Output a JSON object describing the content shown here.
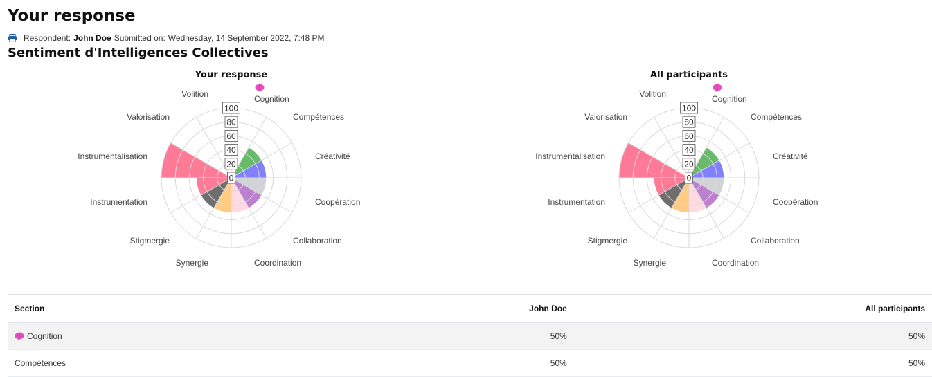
{
  "header": {
    "title": "Your response",
    "respondent_label": "Respondent:",
    "respondent_name": "John Doe",
    "submitted_label": "Submitted on:",
    "submitted_date": "Wednesday, 14 September 2022, 7:48 PM",
    "section_title": "Sentiment d'Intelligences Collectives"
  },
  "colors": {
    "brain_icon": "#e84fbf",
    "print_icon": "#1f5fa8"
  },
  "chart_data": [
    {
      "type": "polar-area",
      "title": "Your response",
      "categories": [
        "Cognition",
        "Compétences",
        "Créativité",
        "Coopération",
        "Collaboration",
        "Coordination",
        "Synergie",
        "Stigmergie",
        "Instrumentation",
        "Instrumentalisation",
        "Valorisation",
        "Volition"
      ],
      "values": [
        0,
        50,
        50,
        50,
        50,
        50,
        50,
        50,
        50,
        100,
        0,
        0
      ],
      "colors": [
        "#ff6384",
        "#4caf50",
        "#6b6bff",
        "#c9cbcf",
        "#b06ac8",
        "#ffd3dc",
        "#ffc36b",
        "#555555",
        "#ff6384",
        "#ff6384",
        "#ff6384",
        "#ff6384"
      ],
      "rlim": [
        0,
        100
      ],
      "ticks": [
        "0",
        "20",
        "40",
        "60",
        "80",
        "100"
      ],
      "grid": true
    },
    {
      "type": "polar-area",
      "title": "All participants",
      "categories": [
        "Cognition",
        "Compétences",
        "Créativité",
        "Coopération",
        "Collaboration",
        "Coordination",
        "Synergie",
        "Stigmergie",
        "Instrumentation",
        "Instrumentalisation",
        "Valorisation",
        "Volition"
      ],
      "values": [
        0,
        50,
        50,
        50,
        50,
        50,
        50,
        50,
        50,
        100,
        0,
        0
      ],
      "colors": [
        "#ff6384",
        "#4caf50",
        "#6b6bff",
        "#c9cbcf",
        "#b06ac8",
        "#ffd3dc",
        "#ffc36b",
        "#555555",
        "#ff6384",
        "#ff6384",
        "#ff6384",
        "#ff6384"
      ],
      "rlim": [
        0,
        100
      ],
      "ticks": [
        "0",
        "20",
        "40",
        "60",
        "80",
        "100"
      ],
      "grid": true
    }
  ],
  "table": {
    "headers": [
      "Section",
      "John Doe",
      "All participants"
    ],
    "rows": [
      {
        "section": "Cognition",
        "icon": "brain-icon",
        "john": "50%",
        "all": "50%"
      },
      {
        "section": "Compétences",
        "john": "50%",
        "all": "50%"
      }
    ]
  }
}
